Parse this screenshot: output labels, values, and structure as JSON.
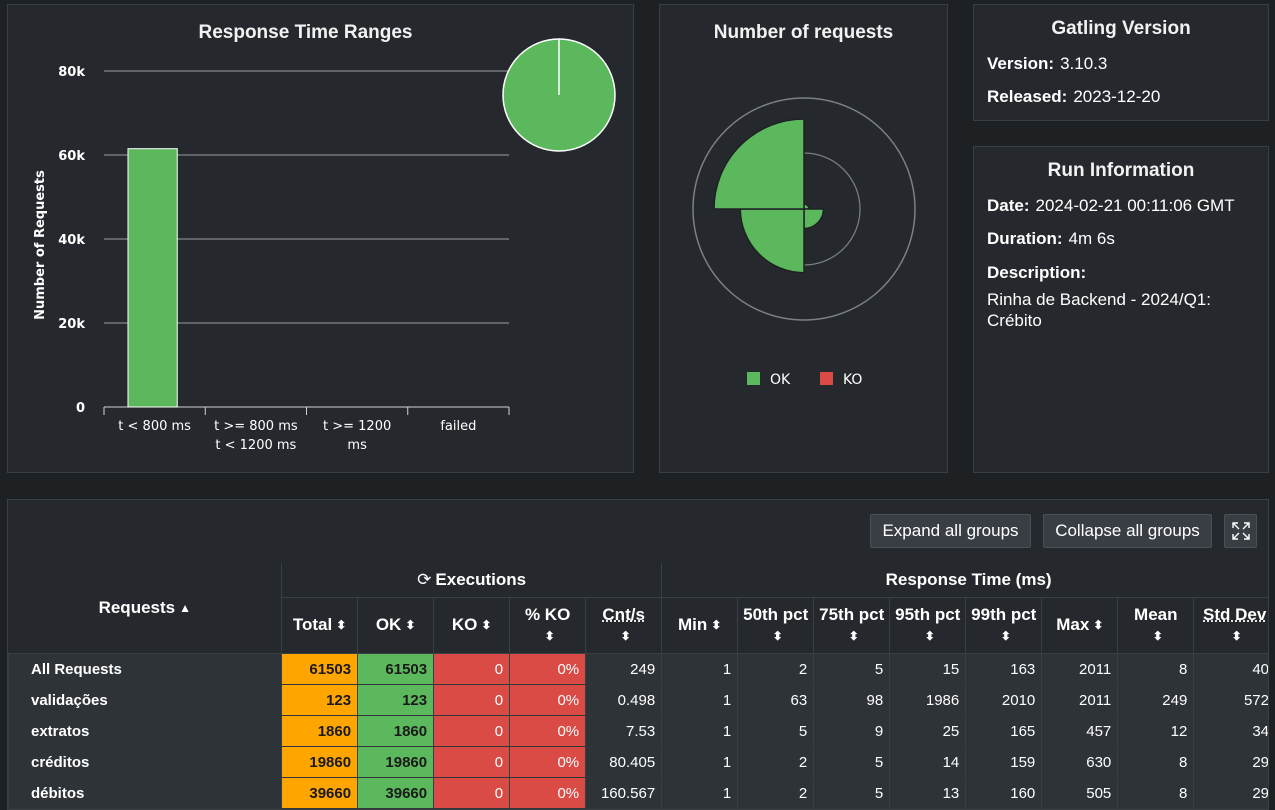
{
  "response_time_ranges": {
    "title": "Response Time Ranges",
    "colors": {
      "ok": "#5cb85c"
    },
    "chart_data": {
      "type": "bar",
      "title": "Response Time Ranges",
      "ylabel": "Number of Requests",
      "ylim": [
        0,
        80000
      ],
      "yticks": [
        "0",
        "20k",
        "40k",
        "60k",
        "80k"
      ],
      "categories": [
        "t < 800 ms",
        "t >= 800 ms t < 1200 ms",
        "t >= 1200 ms",
        "failed"
      ],
      "category_lines": [
        [
          "t < 800 ms"
        ],
        [
          "t >= 800 ms",
          "t < 1200 ms"
        ],
        [
          "t >= 1200",
          "ms"
        ],
        [
          "failed"
        ]
      ],
      "values": [
        61503,
        0,
        0,
        0
      ],
      "pie": {
        "type": "pie",
        "values": [
          61503,
          0,
          0,
          0
        ]
      }
    }
  },
  "number_of_requests": {
    "title": "Number of requests",
    "legend": [
      {
        "label": "OK",
        "color": "#5cb85c"
      },
      {
        "label": "KO",
        "color": "#db4b45"
      }
    ],
    "chart_data": {
      "type": "pie",
      "title": "Number of requests",
      "polar_ticks": [
        "25k",
        "0"
      ],
      "categories": [
        "validações",
        "extratos",
        "créditos",
        "débitos"
      ],
      "series": [
        {
          "name": "OK",
          "values": [
            123,
            1860,
            19860,
            39660
          ]
        },
        {
          "name": "KO",
          "values": [
            0,
            0,
            0,
            0
          ]
        }
      ]
    }
  },
  "gatling_version": {
    "title": "Gatling Version",
    "version_label": "Version:",
    "version": "3.10.3",
    "released_label": "Released:",
    "released": "2023-12-20"
  },
  "run_info": {
    "title": "Run Information",
    "date_label": "Date:",
    "date": "2024-02-21 00:11:06 GMT",
    "duration_label": "Duration:",
    "duration": "4m 6s",
    "description_label": "Description:",
    "description": "Rinha de Backend - 2024/Q1: Crébito"
  },
  "table": {
    "expand_label": "Expand all groups",
    "collapse_label": "Collapse all groups",
    "requests_header": "Requests",
    "executions_header": "Executions",
    "response_time_header": "Response Time (ms)",
    "columns": [
      "Total",
      "OK",
      "KO",
      "% KO",
      "Cnt/s",
      "Min",
      "50th pct",
      "75th pct",
      "95th pct",
      "99th pct",
      "Max",
      "Mean",
      "Std Dev"
    ],
    "rows": [
      [
        "All Requests",
        "61503",
        "61503",
        "0",
        "0%",
        "249",
        "1",
        "2",
        "5",
        "15",
        "163",
        "2011",
        "8",
        "40"
      ],
      [
        "validações",
        "123",
        "123",
        "0",
        "0%",
        "0.498",
        "1",
        "63",
        "98",
        "1986",
        "2010",
        "2011",
        "249",
        "572"
      ],
      [
        "extratos",
        "1860",
        "1860",
        "0",
        "0%",
        "7.53",
        "1",
        "5",
        "9",
        "25",
        "165",
        "457",
        "12",
        "34"
      ],
      [
        "créditos",
        "19860",
        "19860",
        "0",
        "0%",
        "80.405",
        "1",
        "2",
        "5",
        "14",
        "159",
        "630",
        "8",
        "29"
      ],
      [
        "débitos",
        "39660",
        "39660",
        "0",
        "0%",
        "160.567",
        "1",
        "2",
        "5",
        "13",
        "160",
        "505",
        "8",
        "29"
      ]
    ]
  }
}
